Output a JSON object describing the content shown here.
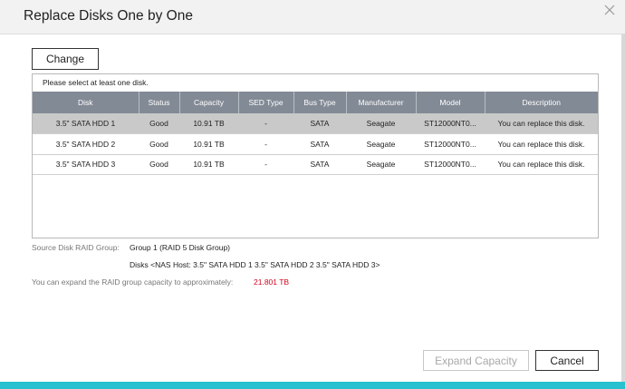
{
  "dialog": {
    "title": "Replace Disks One by One",
    "close_icon": "close-icon"
  },
  "toolbar": {
    "change_label": "Change"
  },
  "table": {
    "notice": "Please select at least one disk.",
    "columns": [
      "Disk",
      "Status",
      "Capacity",
      "SED Type",
      "Bus Type",
      "Manufacturer",
      "Model",
      "Description"
    ],
    "rows": [
      [
        "3.5\" SATA HDD 1",
        "Good",
        "10.91 TB",
        "-",
        "SATA",
        "Seagate",
        "ST12000NT0...",
        "You can replace this disk."
      ],
      [
        "3.5\" SATA HDD 2",
        "Good",
        "10.91 TB",
        "-",
        "SATA",
        "Seagate",
        "ST12000NT0...",
        "You can replace this disk."
      ],
      [
        "3.5\" SATA HDD 3",
        "Good",
        "10.91 TB",
        "-",
        "SATA",
        "Seagate",
        "ST12000NT0...",
        "You can replace this disk."
      ]
    ],
    "selected_row": 0
  },
  "info": {
    "source_label": "Source Disk RAID Group:",
    "source_value": "Group 1 (RAID 5 Disk Group)",
    "disks_value": "Disks <NAS Host: 3.5\" SATA HDD 1 3.5\" SATA HDD 2 3.5\" SATA HDD 3>",
    "expand_label": "You can expand the RAID group capacity to approximately:",
    "expand_value": "21.801 TB"
  },
  "footer": {
    "expand_label": "Expand Capacity",
    "cancel_label": "Cancel"
  },
  "colors": {
    "header_bg": "#828a95",
    "selected_row": "#c9c9c9",
    "accent_bar": "#27c1cf",
    "capacity_red": "#d0021b"
  }
}
